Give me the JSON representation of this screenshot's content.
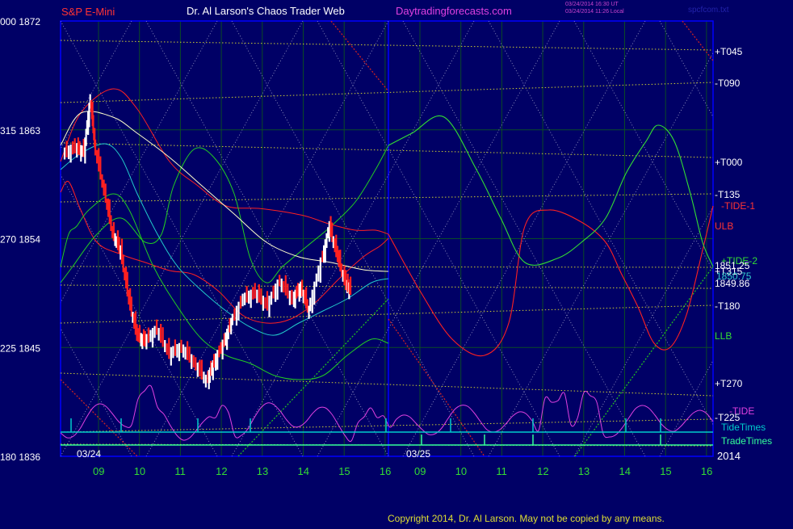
{
  "header": {
    "symbol": "S&P E-Mini",
    "title": "Dr. Al Larson's Chaos Trader Web",
    "site": "Daytradingforecasts.com",
    "stamp_line1": "03/24/2014 16:30 UT",
    "stamp_line2": "03/24/2014 11:26 Local",
    "filename": "spcfcom.txt"
  },
  "footer": {
    "copyright": "Copyright 2014, Dr. Al Larson. May not be copied by any means."
  },
  "colors": {
    "background": "#000066",
    "panel_border": "#0000ff",
    "price_up": "#ffffff",
    "price_down": "#ff2020",
    "tide": "#e040e0",
    "tide_times": "#00cccc",
    "trade_times": "#33ff99",
    "ulb": "#ff2020",
    "llb": "#22cc22",
    "ma_cyan": "#22cccc",
    "ma_white": "#ffffcc",
    "tide1": "#ff2020",
    "tide2": "#33dd33",
    "yellow_lines": "#cccc33"
  },
  "chart_data": {
    "type": "line",
    "title": "S&P E-Mini",
    "xlabel": "",
    "ylabel": "",
    "ylim": [
      1836,
      1872
    ],
    "y_ticks": [
      {
        "label": "000  1872",
        "value": 1872
      },
      {
        "label": "315  1863",
        "value": 1863
      },
      {
        "label": "270  1854",
        "value": 1854
      },
      {
        "label": "225  1845",
        "value": 1845
      },
      {
        "label": "180  1836",
        "value": 1836
      }
    ],
    "x_ticks_day1": [
      "09",
      "10",
      "11",
      "12",
      "13",
      "14",
      "15",
      "16"
    ],
    "x_ticks_day2": [
      "09",
      "10",
      "11",
      "12",
      "13",
      "14",
      "15",
      "16"
    ],
    "dates": [
      "03/24",
      "03/25"
    ],
    "year": "2014",
    "right_labels": [
      {
        "text": "+T045",
        "color": "#ffffff"
      },
      {
        "text": "-T090",
        "color": "#ffffff"
      },
      {
        "text": "+T000",
        "color": "#ffffff"
      },
      {
        "text": "-T135",
        "color": "#ffffff"
      },
      {
        "text": "-TIDE-1",
        "color": "#ff3333"
      },
      {
        "text": "ULB",
        "color": "#ff3333"
      },
      {
        "text": "+TIDE-2",
        "color": "#33dd33"
      },
      {
        "text": "1851.25",
        "color": "#ffffff"
      },
      {
        "text": "+T315",
        "color": "#ffffff"
      },
      {
        "text": "1850.75",
        "color": "#33cccc"
      },
      {
        "text": "1849.86",
        "color": "#ffffff"
      },
      {
        "text": "-T180",
        "color": "#ffffff"
      },
      {
        "text": "LLB",
        "color": "#33dd33"
      },
      {
        "text": "+T270",
        "color": "#ffffff"
      },
      {
        "text": "-TIDE",
        "color": "#e040e0"
      },
      {
        "text": "-T225",
        "color": "#ffffff"
      },
      {
        "text": "TideTimes",
        "color": "#00cccc"
      },
      {
        "text": "TradeTimes",
        "color": "#33ff99"
      }
    ],
    "series": [
      {
        "name": "S&P E-Mini",
        "x": [
          9.0,
          9.3,
          9.5,
          9.65,
          9.75,
          10.0,
          10.2,
          10.4,
          10.6,
          10.8,
          11.0,
          11.3,
          11.6,
          11.9,
          12.2,
          12.5,
          12.65,
          12.9,
          13.1,
          13.4,
          13.7,
          14.0,
          14.3,
          14.6,
          14.8,
          15.0,
          15.3,
          15.5,
          15.7,
          15.9,
          16.0
        ],
        "y": [
          1861.0,
          1861.5,
          1861.2,
          1865.5,
          1862.0,
          1858.0,
          1854.5,
          1853.0,
          1849.0,
          1846.0,
          1845.5,
          1846.5,
          1844.5,
          1845.0,
          1843.8,
          1842.3,
          1843.5,
          1845.2,
          1847.0,
          1849.0,
          1849.5,
          1848.5,
          1850.5,
          1849.0,
          1850.0,
          1848.0,
          1852.0,
          1855.0,
          1852.5,
          1850.2,
          1849.8
        ]
      }
    ]
  }
}
